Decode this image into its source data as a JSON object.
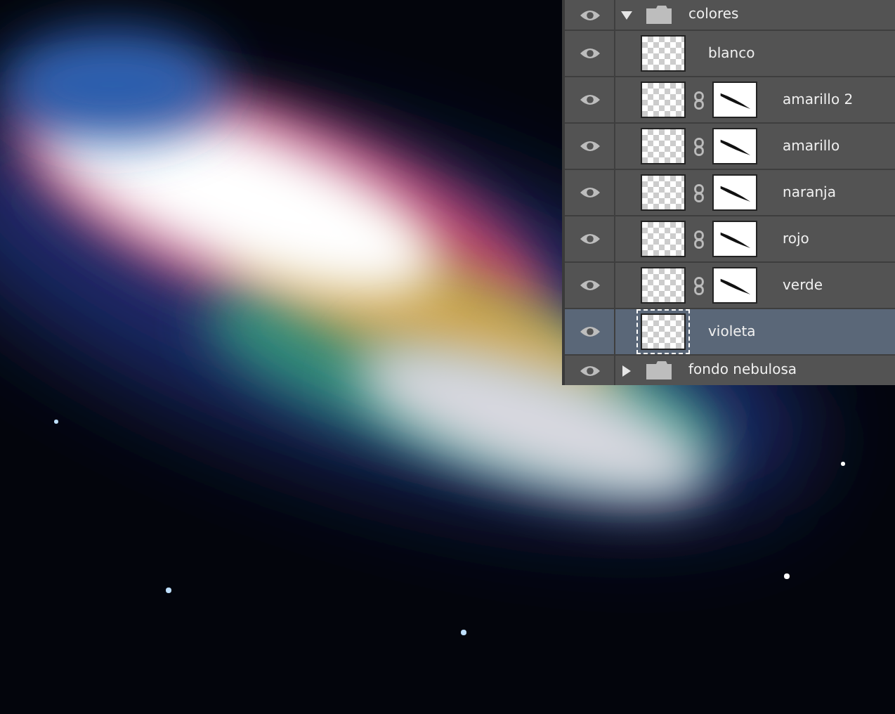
{
  "layers_panel": {
    "layers": [
      {
        "kind": "group",
        "name": "colores",
        "visible": true,
        "expanded": true,
        "selected": false,
        "children": [
          {
            "kind": "layer",
            "name": "blanco",
            "visible": true,
            "selected": false,
            "has_mask": false
          },
          {
            "kind": "layer",
            "name": "amarillo 2",
            "visible": true,
            "selected": false,
            "has_mask": true
          },
          {
            "kind": "layer",
            "name": "amarillo",
            "visible": true,
            "selected": false,
            "has_mask": true
          },
          {
            "kind": "layer",
            "name": "naranja",
            "visible": true,
            "selected": false,
            "has_mask": true
          },
          {
            "kind": "layer",
            "name": "rojo",
            "visible": true,
            "selected": false,
            "has_mask": true
          },
          {
            "kind": "layer",
            "name": "verde",
            "visible": true,
            "selected": false,
            "has_mask": true
          },
          {
            "kind": "layer",
            "name": "violeta",
            "visible": true,
            "selected": true,
            "has_mask": false
          }
        ]
      },
      {
        "kind": "group",
        "name": "fondo nebulosa",
        "visible": true,
        "expanded": false,
        "selected": false
      }
    ]
  }
}
